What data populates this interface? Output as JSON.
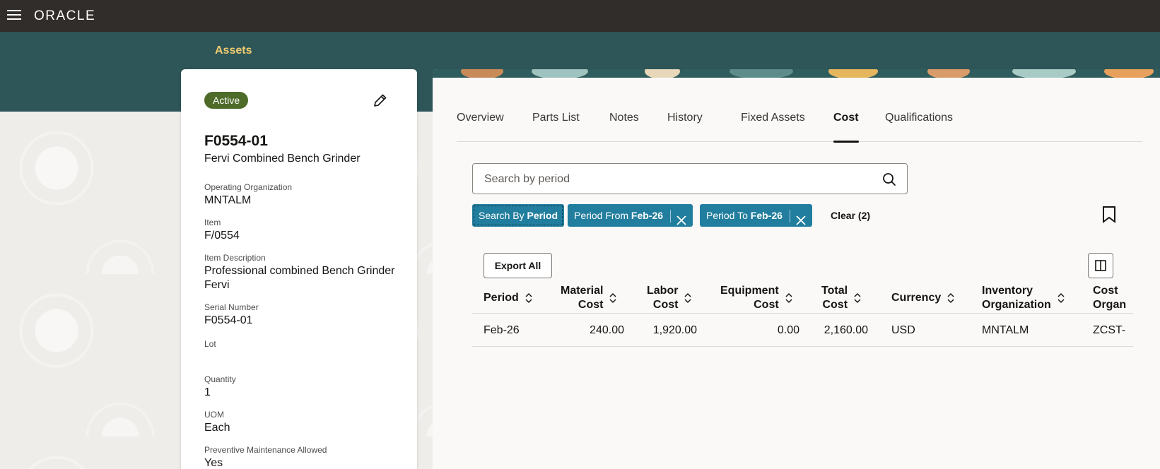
{
  "header": {
    "logo": "ORACLE"
  },
  "breadcrumb": "Assets",
  "asset": {
    "status": "Active",
    "number": "F0554-01",
    "name": "Fervi Combined Bench Grinder",
    "fields": [
      {
        "label": "Operating Organization",
        "value": "MNTALM"
      },
      {
        "label": "Item",
        "value": "F/0554"
      },
      {
        "label": "Item Description",
        "value": "Professional combined Bench Grinder Fervi"
      },
      {
        "label": "Serial Number",
        "value": "F0554-01"
      },
      {
        "label": "Lot",
        "value": ""
      },
      {
        "label": "Quantity",
        "value": "1"
      },
      {
        "label": "UOM",
        "value": "Each"
      },
      {
        "label": "Preventive Maintenance Allowed",
        "value": "Yes"
      }
    ]
  },
  "tabs": [
    "Overview",
    "Parts List",
    "Notes",
    "History",
    "Fixed Assets",
    "Cost",
    "Qualifications"
  ],
  "active_tab": "Cost",
  "search": {
    "placeholder": "Search by period"
  },
  "chips": [
    {
      "prefix": "Search By ",
      "value": "Period"
    },
    {
      "prefix": "Period From ",
      "value": "Feb-26"
    },
    {
      "prefix": "Period To ",
      "value": "Feb-26"
    }
  ],
  "clear_label": "Clear (2)",
  "export_label": "Export All",
  "table": {
    "columns": [
      {
        "line1": "Period",
        "line2": ""
      },
      {
        "line1": "Material",
        "line2": "Cost"
      },
      {
        "line1": "Labor",
        "line2": "Cost"
      },
      {
        "line1": "Equipment",
        "line2": "Cost"
      },
      {
        "line1": "Total",
        "line2": "Cost"
      },
      {
        "line1": "Currency",
        "line2": ""
      },
      {
        "line1": "Inventory",
        "line2": "Organization"
      },
      {
        "line1": "Cost",
        "line2": "Organ"
      }
    ],
    "rows": [
      [
        "Feb-26",
        "240.00",
        "1,920.00",
        "0.00",
        "2,160.00",
        "USD",
        "MNTALM",
        "ZCST-"
      ]
    ]
  },
  "colors": {
    "topbar": "#312d2a",
    "banner": "#2e5658",
    "breadcrumb": "#f0cc71",
    "chip": "#227e9e",
    "badge": "#4e6b2a"
  }
}
